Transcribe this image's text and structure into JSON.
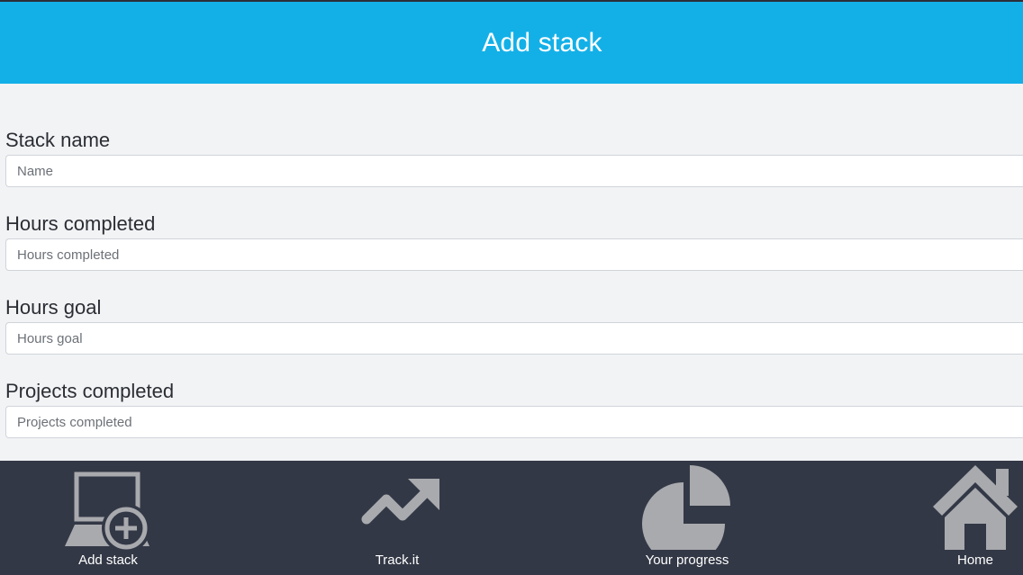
{
  "header": {
    "title": "Add stack"
  },
  "form": {
    "fields": [
      {
        "label": "Stack name",
        "placeholder": "Name",
        "value": ""
      },
      {
        "label": "Hours completed",
        "placeholder": "Hours completed",
        "value": ""
      },
      {
        "label": "Hours goal",
        "placeholder": "Hours goal",
        "value": ""
      },
      {
        "label": "Projects completed",
        "placeholder": "Projects completed",
        "value": ""
      }
    ]
  },
  "nav": {
    "items": [
      {
        "label": "Add stack",
        "icon": "laptop-add-icon"
      },
      {
        "label": "Track.it",
        "icon": "trend-up-icon"
      },
      {
        "label": "Your progress",
        "icon": "pie-chart-icon"
      },
      {
        "label": "Home",
        "icon": "home-icon"
      }
    ]
  },
  "colors": {
    "header_bg": "#13b0e8",
    "nav_bg": "#333846",
    "page_bg": "#f2f3f5",
    "icon_gray": "#a9aaae"
  }
}
